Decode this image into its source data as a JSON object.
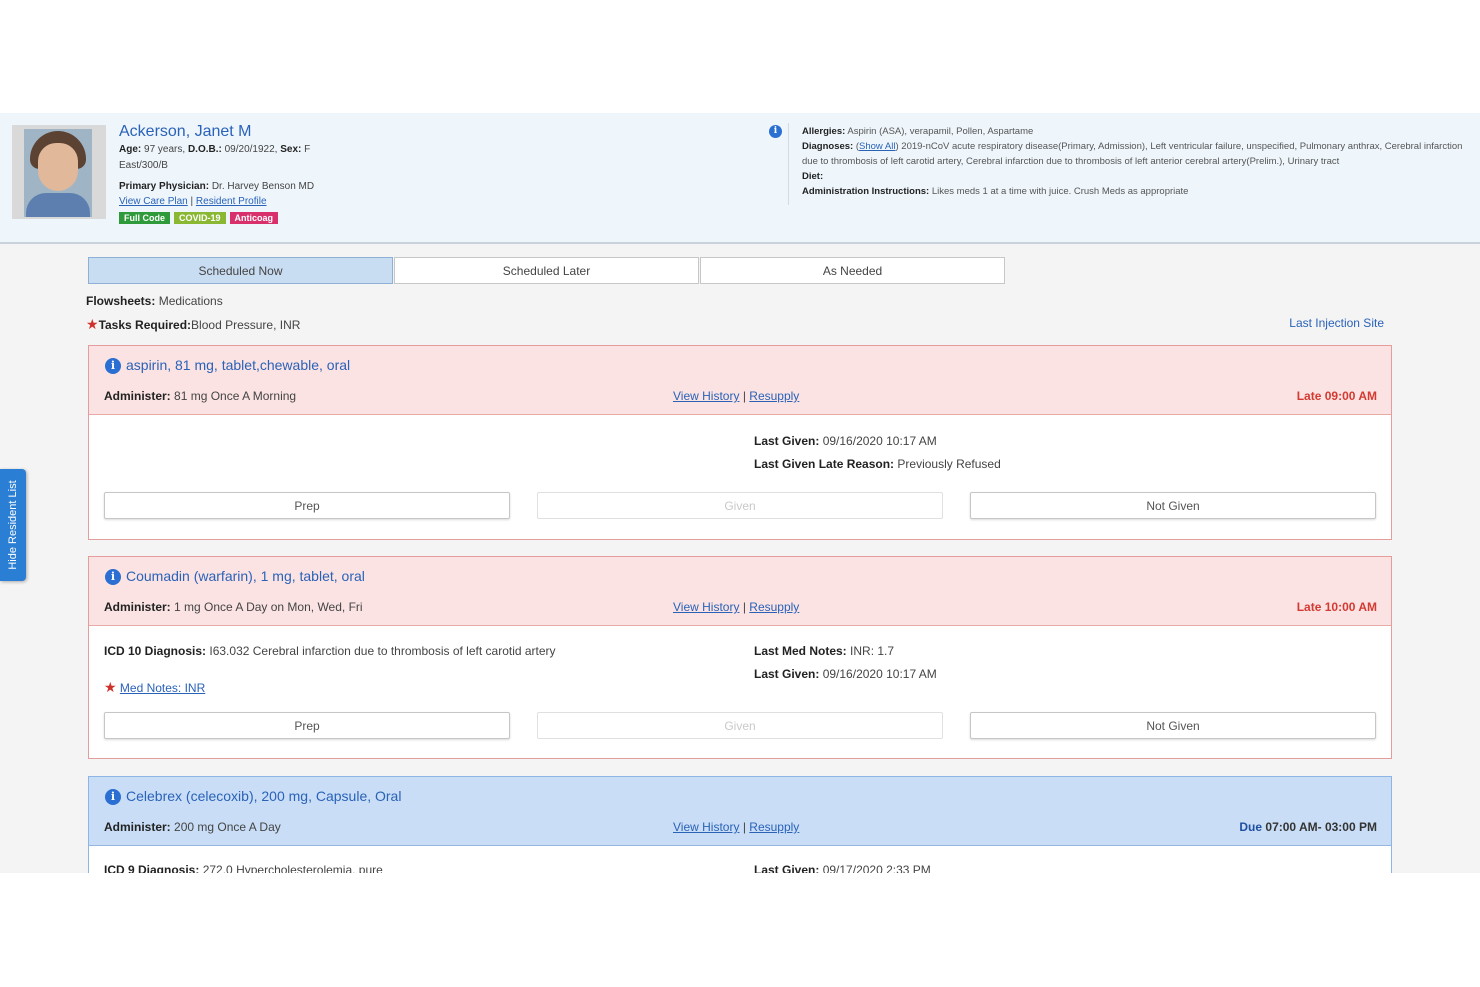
{
  "resident": {
    "name": "Ackerson, Janet M",
    "age_label": "Age:",
    "age": "97 years,",
    "dob_label": "D.O.B.:",
    "dob": "09/20/1922,",
    "sex_label": "Sex:",
    "sex": "F",
    "room": "East/300/B",
    "physician_label": "Primary Physician:",
    "physician": "Dr. Harvey Benson MD",
    "view_care_plan": "View Care Plan",
    "resident_profile": "Resident Profile",
    "badges": [
      {
        "label": "Full Code",
        "color": "#2e9a3a"
      },
      {
        "label": "COVID-19",
        "color": "#8ab833"
      },
      {
        "label": "Anticoag",
        "color": "#d8306a"
      }
    ]
  },
  "clinical": {
    "allergies_label": "Allergies:",
    "allergies": "Aspirin (ASA), verapamil, Pollen, Aspartame",
    "diagnoses_label": "Diagnoses:",
    "show_all": "Show All",
    "diagnoses": "2019-nCoV acute respiratory disease(Primary, Admission), Left ventricular failure, unspecified, Pulmonary anthrax, Cerebral infarction due to thrombosis of left carotid artery, Cerebral infarction due to thrombosis of left anterior cerebral artery(Prelim.), Urinary tract",
    "diet_label": "Diet:",
    "admin_label": "Administration Instructions:",
    "admin_instructions": "Likes meds 1 at a time with juice. Crush Meds as appropriate"
  },
  "side_tab": "Hide Resident List",
  "tabs": [
    "Scheduled Now",
    "Scheduled Later",
    "As Needed"
  ],
  "flowsheets_label": "Flowsheets:",
  "flowsheets": "Medications",
  "tasks_label": "Tasks Required:",
  "tasks": "Blood Pressure, INR",
  "last_injection_site": "Last Injection Site",
  "common": {
    "administer_label": "Administer:",
    "view_history": "View History",
    "resupply": "Resupply",
    "separator": "|",
    "prep": "Prep",
    "given": "Given",
    "not_given": "Not Given",
    "last_given_label": "Last Given:",
    "late_reason_label": "Last Given Late Reason:",
    "last_med_notes_label": "Last Med Notes:",
    "icd10_label": "ICD 10 Diagnosis:",
    "icd9_label": "ICD 9 Diagnosis:"
  },
  "meds": [
    {
      "title": "aspirin, 81 mg, tablet,chewable, oral",
      "administer": "81 mg Once A Morning",
      "status_word": "Late",
      "status_time": "09:00 AM",
      "last_given": "09/16/2020 10:17 AM",
      "late_reason": "Previously Refused"
    },
    {
      "title": "Coumadin (warfarin), 1 mg, tablet, oral",
      "administer": "1 mg Once A Day on Mon, Wed, Fri",
      "status_word": "Late",
      "status_time": "10:00 AM",
      "icd10": "I63.032 Cerebral infarction due to thrombosis of left carotid artery",
      "last_med_notes": "INR: 1.7",
      "last_given": "09/16/2020 10:17 AM",
      "med_notes_link": "Med Notes: INR"
    },
    {
      "title": "Celebrex (celecoxib), 200 mg, Capsule, Oral",
      "administer": "200 mg Once A Day",
      "status_word": "Due",
      "status_time": "07:00 AM- 03:00 PM",
      "icd9": "272.0 Hypercholesterolemia, pure",
      "last_given": "09/17/2020 2:33 PM"
    }
  ]
}
